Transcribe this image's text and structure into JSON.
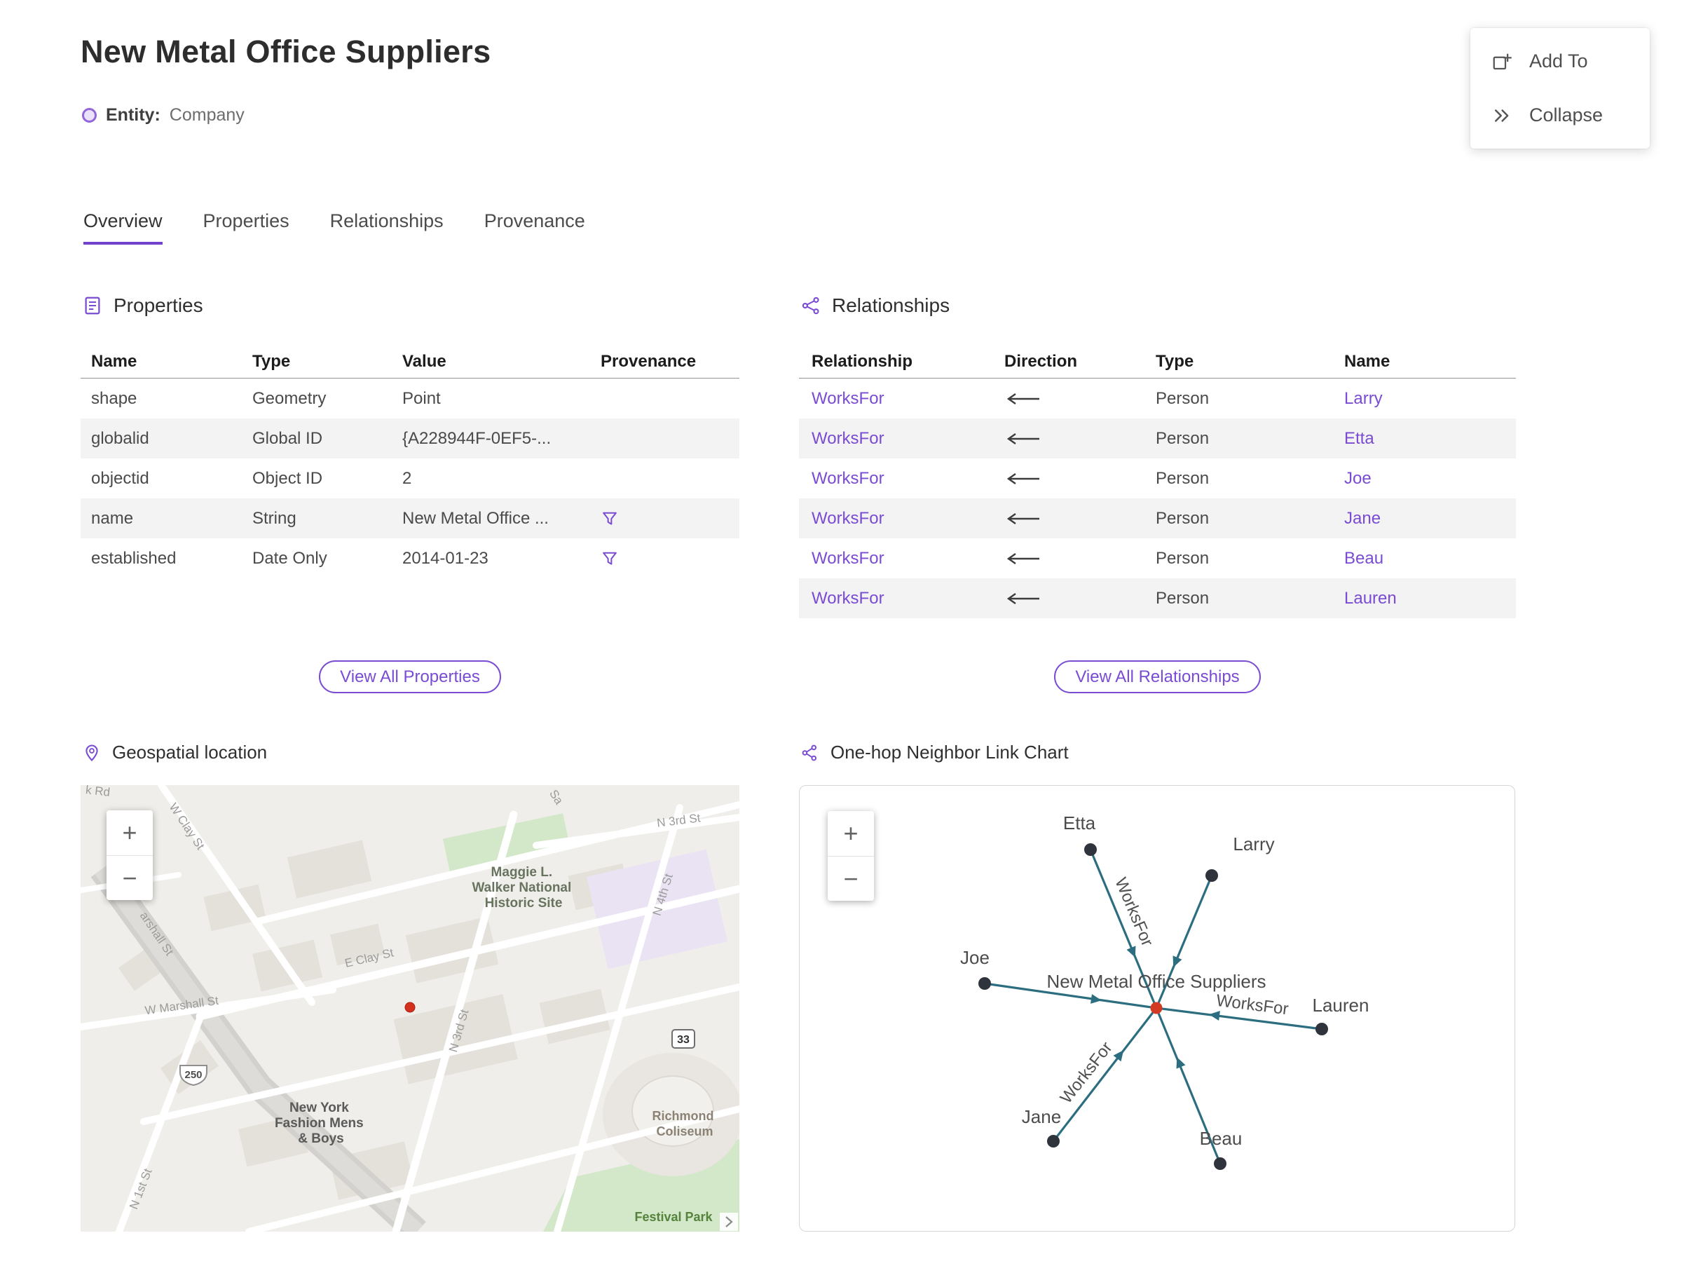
{
  "header": {
    "title": "New Metal Office Suppliers",
    "entity_label": "Entity:",
    "entity_type": "Company"
  },
  "action_menu": {
    "add_to": "Add To",
    "collapse": "Collapse"
  },
  "tabs": {
    "overview": "Overview",
    "properties": "Properties",
    "relationships": "Relationships",
    "provenance": "Provenance"
  },
  "zoom": {
    "in": "+",
    "out": "−"
  },
  "properties": {
    "heading": "Properties",
    "col_name": "Name",
    "col_type": "Type",
    "col_value": "Value",
    "col_provenance": "Provenance",
    "rows": [
      {
        "name": "shape",
        "type": "Geometry",
        "value": "Point",
        "provenance": false
      },
      {
        "name": "globalid",
        "type": "Global ID",
        "value": "{A228944F-0EF5-...",
        "provenance": false
      },
      {
        "name": "objectid",
        "type": "Object ID",
        "value": "2",
        "provenance": false
      },
      {
        "name": "name",
        "type": "String",
        "value": "New Metal Office ...",
        "provenance": true
      },
      {
        "name": "established",
        "type": "Date Only",
        "value": "2014-01-23",
        "provenance": true
      }
    ],
    "view_all": "View All Properties"
  },
  "relationships": {
    "heading": "Relationships",
    "col_relationship": "Relationship",
    "col_direction": "Direction",
    "col_type": "Type",
    "col_name": "Name",
    "rows": [
      {
        "relationship": "WorksFor",
        "direction": "←",
        "type": "Person",
        "name": "Larry"
      },
      {
        "relationship": "WorksFor",
        "direction": "←",
        "type": "Person",
        "name": "Etta"
      },
      {
        "relationship": "WorksFor",
        "direction": "←",
        "type": "Person",
        "name": "Joe"
      },
      {
        "relationship": "WorksFor",
        "direction": "←",
        "type": "Person",
        "name": "Jane"
      },
      {
        "relationship": "WorksFor",
        "direction": "←",
        "type": "Person",
        "name": "Beau"
      },
      {
        "relationship": "WorksFor",
        "direction": "←",
        "type": "Person",
        "name": "Lauren"
      }
    ],
    "view_all": "View All Relationships"
  },
  "map": {
    "heading": "Geospatial location",
    "shields": {
      "us250": "250",
      "sr33": "33"
    },
    "poi": {
      "historic_site": [
        "Maggie L.",
        "Walker National",
        "Historic Site"
      ],
      "fashion": [
        "New York",
        "Fashion Mens",
        "& Boys"
      ],
      "coliseum": [
        "Richmond",
        "Coliseum"
      ],
      "festival_park": "Festival Park"
    },
    "streets": {
      "k_rd": "k Rd",
      "sal": "Sa",
      "w_clay": "W Clay St",
      "marshall": "arshall St",
      "w_marshall": "W Marshall St",
      "e_clay": "E Clay St",
      "n3rd": "N 3rd St",
      "n3rd_top": "N 3rd St",
      "n4th": "N 4th St",
      "n1st": "N 1st St"
    }
  },
  "link_chart": {
    "heading": "One-hop Neighbor Link Chart",
    "center_label": "New Metal Office Suppliers",
    "edge_label": "WorksFor",
    "nodes": {
      "etta": "Etta",
      "larry": "Larry",
      "joe": "Joe",
      "lauren": "Lauren",
      "jane": "Jane",
      "beau": "Beau"
    }
  },
  "colors": {
    "accent_purple": "#7a4bd3",
    "tab_underline": "#7342cc",
    "edge_teal": "#2c6e80",
    "node_dark": "#2e333c",
    "center_node_red": "#d23a23",
    "row_alt_gray": "#f3f3f3",
    "marker_red": "#d2311e"
  }
}
